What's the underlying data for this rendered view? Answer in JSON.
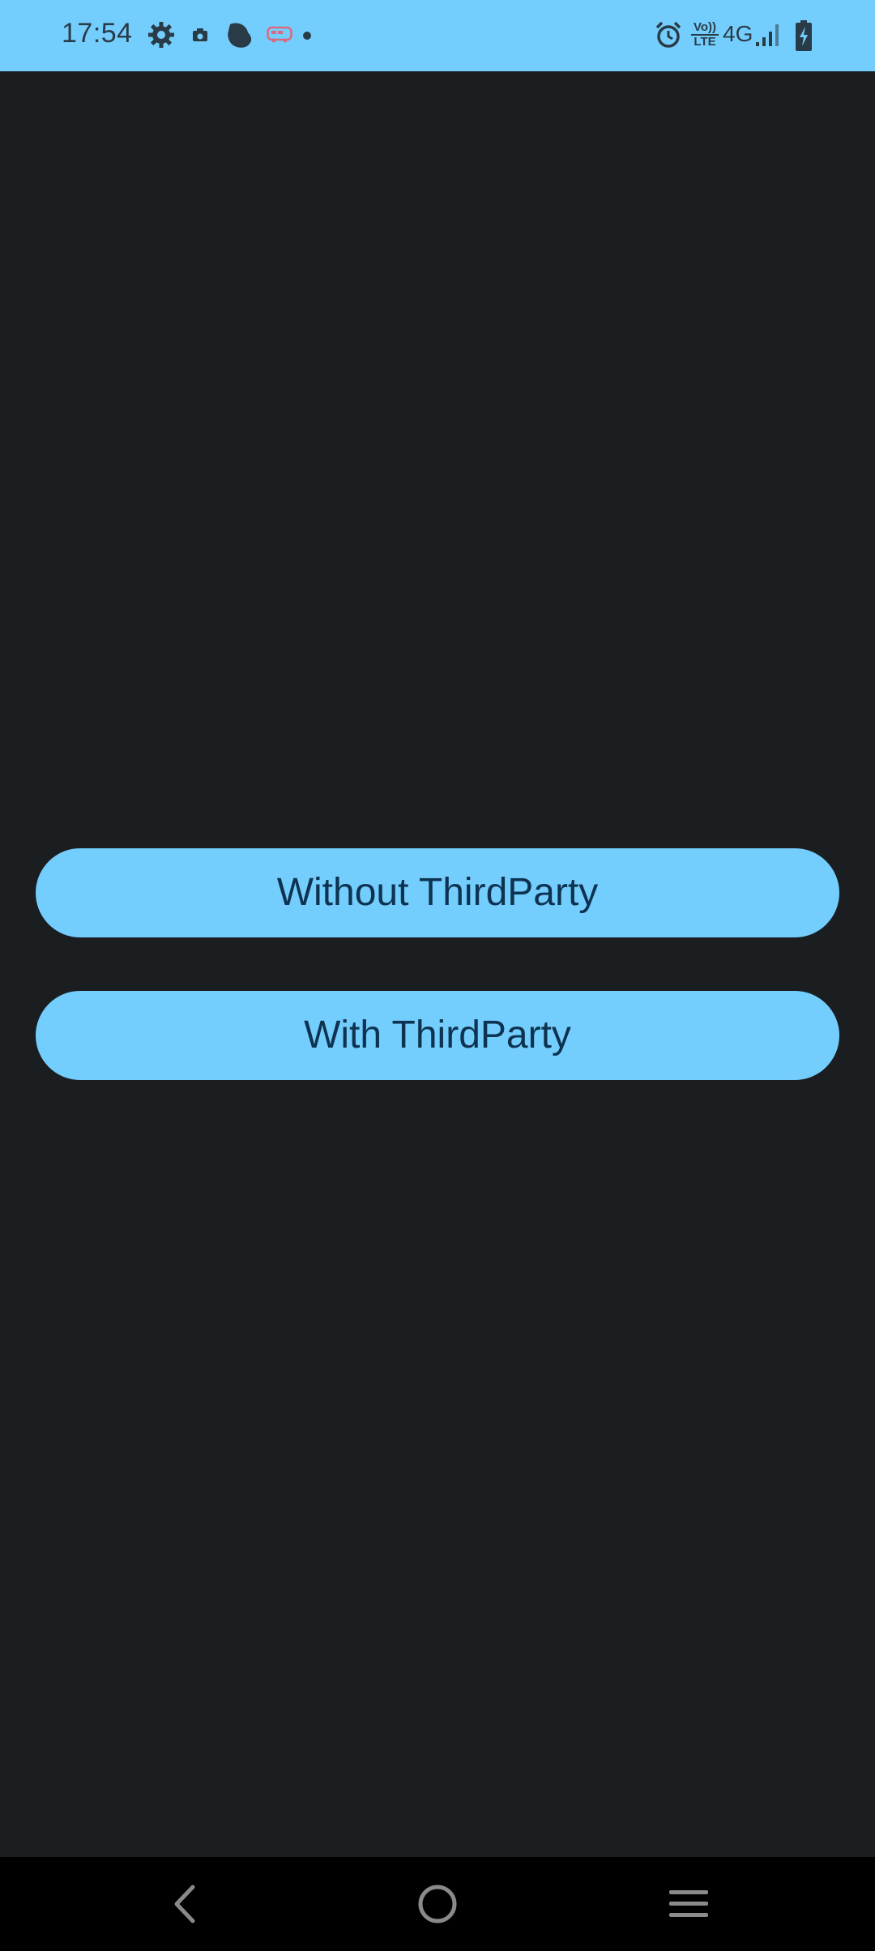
{
  "status_bar": {
    "time": "17:54",
    "background_color": "#74cefd",
    "left_icons": [
      "settings-gear-icon",
      "camera-icon",
      "app-notification-icon",
      "bus-icon",
      "notification-dot-icon"
    ],
    "right_icons": [
      "alarm-icon",
      "volte-icon",
      "network-4g-icon",
      "signal-icon",
      "battery-charging-icon"
    ],
    "network_label": "4G",
    "volte_top": "Vo))",
    "volte_bottom": "LTE"
  },
  "main": {
    "background_color": "#1b1e21",
    "buttons": [
      {
        "label": "Without ThirdParty"
      },
      {
        "label": "With ThirdParty"
      }
    ],
    "button_color": "#74cefd",
    "button_text_color": "#0e3350"
  },
  "nav_bar": {
    "items": [
      "back-icon",
      "home-icon",
      "recents-icon"
    ]
  }
}
